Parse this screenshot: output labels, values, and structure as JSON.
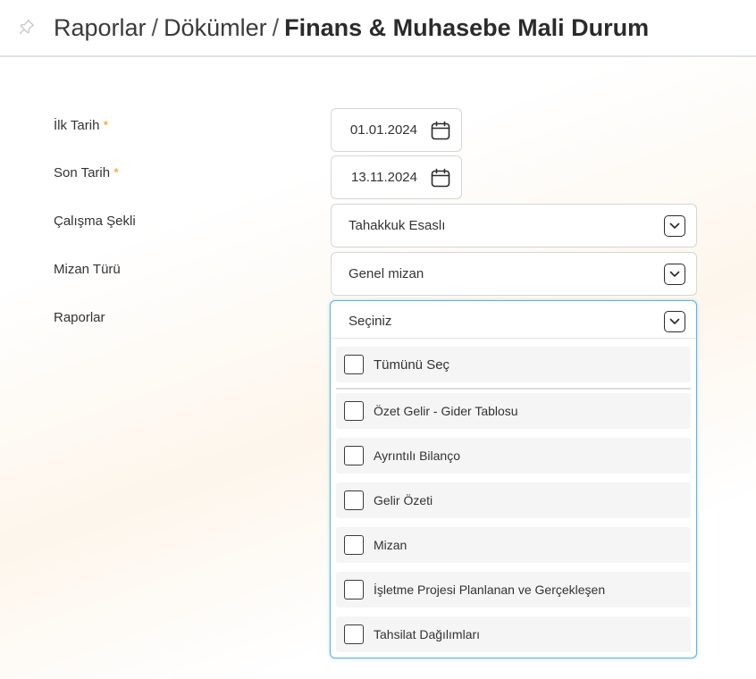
{
  "header": {
    "breadcrumb": [
      "Raporlar",
      "Dökümler"
    ],
    "current": "Finans & Muhasebe Mali Durum",
    "separator": "/",
    "icon": "pin-icon"
  },
  "form": {
    "start_date": {
      "label": "İlk Tarih",
      "required_mark": "*",
      "value": "01.01.2024",
      "icon": "calendar-icon"
    },
    "end_date": {
      "label": "Son Tarih",
      "required_mark": "*",
      "value": "13.11.2024",
      "icon": "calendar-icon"
    },
    "work_type": {
      "label": "Çalışma Şekli",
      "value": "Tahakkuk Esaslı",
      "icon": "chevron-down-icon"
    },
    "mizan_type": {
      "label": "Mizan Türü",
      "value": "Genel mizan",
      "icon": "chevron-down-icon"
    },
    "reports": {
      "label": "Raporlar",
      "placeholder": "Seçiniz",
      "select_all": "Tümünü Seç",
      "options": [
        "Özet Gelir - Gider Tablosu",
        "Ayrıntılı Bilanço",
        "Gelir Özeti",
        "Mizan",
        "İşletme Projesi Planlanan ve Gerçekleşen",
        "Tahsilat Dağılımları"
      ]
    }
  },
  "colors": {
    "required": "#f0a020",
    "focus_border": "#58b6e4",
    "option_bg": "#f5f5f5"
  }
}
